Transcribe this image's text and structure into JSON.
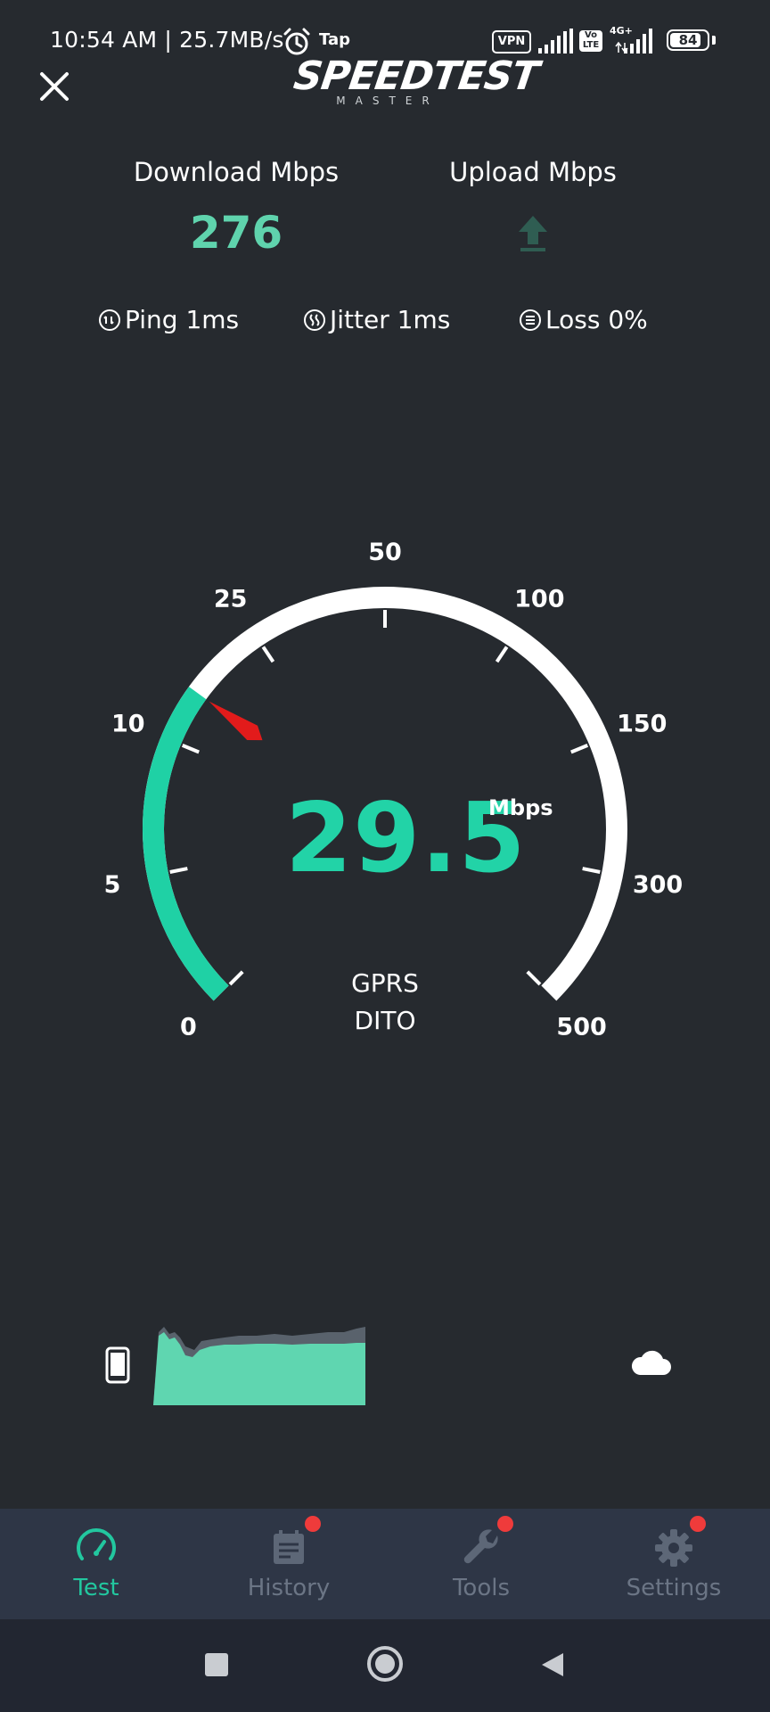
{
  "status_bar": {
    "time": "10:54 AM | 25.7MB/s",
    "tap_label": "Tap",
    "vpn_label": "VPN",
    "volte_label": "Vo LTE",
    "network_label": "4G+",
    "battery_level": "84",
    "battery_fraction": 0.84
  },
  "header": {
    "logo_main": "SPEEDTEST",
    "logo_sub": "MASTER",
    "close_icon": "close-icon"
  },
  "results": {
    "download_label": "Download Mbps",
    "download_value": "276",
    "upload_label": "Upload Mbps",
    "upload_icon": "upload-arrow-icon"
  },
  "metrics": {
    "ping": "Ping 1ms",
    "jitter": "Jitter 1ms",
    "loss": "Loss 0%"
  },
  "gauge": {
    "value": "29.5",
    "unit": "Mbps",
    "network_type": "GPRS",
    "carrier": "DITO",
    "scale_labels": [
      "0",
      "5",
      "10",
      "25",
      "50",
      "100",
      "150",
      "300",
      "500"
    ],
    "progress_fraction": 0.3,
    "colors": {
      "active": "#1fd1a5",
      "track": "#ffffff",
      "needle": "#e21b1b"
    }
  },
  "graph": {
    "left_icon": "phone-icon",
    "right_icon": "cloud-icon",
    "fill_color": "#5fd6b0"
  },
  "bottom_nav": {
    "items": [
      {
        "label": "Test",
        "icon": "speedometer-icon",
        "active": true,
        "badge": false
      },
      {
        "label": "History",
        "icon": "history-icon",
        "active": false,
        "badge": true
      },
      {
        "label": "Tools",
        "icon": "wrench-icon",
        "active": false,
        "badge": true
      },
      {
        "label": "Settings",
        "icon": "gear-icon",
        "active": false,
        "badge": true
      }
    ]
  },
  "colors": {
    "background": "#262a2f",
    "accent": "#22d3a7",
    "nav_background": "#2e3646",
    "badge": "#ef3b3b"
  }
}
